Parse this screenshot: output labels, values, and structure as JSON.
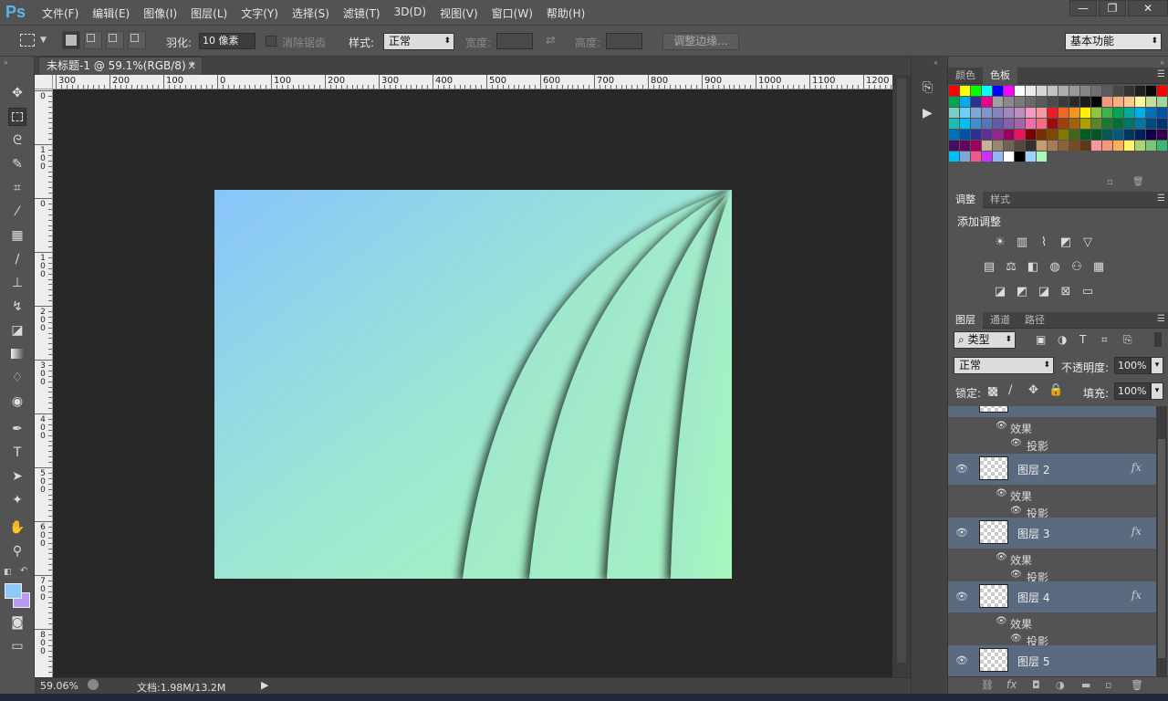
{
  "app": {
    "logo": "Ps"
  },
  "menu": [
    "文件(F)",
    "编辑(E)",
    "图像(I)",
    "图层(L)",
    "文字(Y)",
    "选择(S)",
    "滤镜(T)",
    "3D(D)",
    "视图(V)",
    "窗口(W)",
    "帮助(H)"
  ],
  "window_controls": {
    "minimize": "—",
    "restore": "❐",
    "close": "✕"
  },
  "options": {
    "feather_label": "羽化:",
    "feather_value": "10 像素",
    "antialias_label": "消除锯齿",
    "style_label": "样式:",
    "style_value": "正常",
    "width_label": "宽度:",
    "height_label": "高度:",
    "refine_edge": "调整边缘...",
    "workspace": "基本功能"
  },
  "document": {
    "tab_title": "未标题-1 @ 59.1%(RGB/8) *",
    "close": "×"
  },
  "ruler": {
    "h_labels": [
      "300",
      "200",
      "100",
      "0",
      "100",
      "200",
      "300",
      "400",
      "500",
      "600",
      "700",
      "800",
      "900",
      "1000",
      "1100",
      "1200"
    ],
    "v_labels": [
      "0",
      "1\n0\n0",
      "0",
      "1\n0\n0",
      "2\n0\n0",
      "3\n0\n0",
      "4\n0\n0",
      "5\n0\n0",
      "6\n0\n0",
      "7\n0\n0",
      "8\n0\n0"
    ]
  },
  "status": {
    "zoom": "59.06%",
    "doc_info": "文档:1.98M/13.2M"
  },
  "panels": {
    "color_tabs": [
      "颜色",
      "色板"
    ],
    "adjust_tabs": [
      "调整",
      "样式"
    ],
    "adjust_title": "添加调整",
    "layers_tabs": [
      "图层",
      "通道",
      "路径"
    ],
    "filter_kind": "类型",
    "blend_mode": "正常",
    "opacity_label": "不透明度:",
    "opacity_value": "100%",
    "lock_label": "锁定:",
    "fill_label": "填充:",
    "fill_value": "100%"
  },
  "layers": [
    {
      "name": "图层 2",
      "fx": "fx",
      "effects_label": "效果",
      "effect": "投影"
    },
    {
      "name": "图层 3",
      "fx": "fx",
      "effects_label": "效果",
      "effect": "投影"
    },
    {
      "name": "图层 4",
      "fx": "fx",
      "effects_label": "效果",
      "effect": "投影"
    },
    {
      "name": "图层 5"
    }
  ],
  "partial_layer": {
    "effects_label": "效果",
    "effect": "投影"
  },
  "colors": {
    "accent": "#5ab4f0",
    "canvas_top": "#8ec8f8",
    "canvas_bottom": "#a8f8bc",
    "selected_layer": "#5a6a80"
  }
}
